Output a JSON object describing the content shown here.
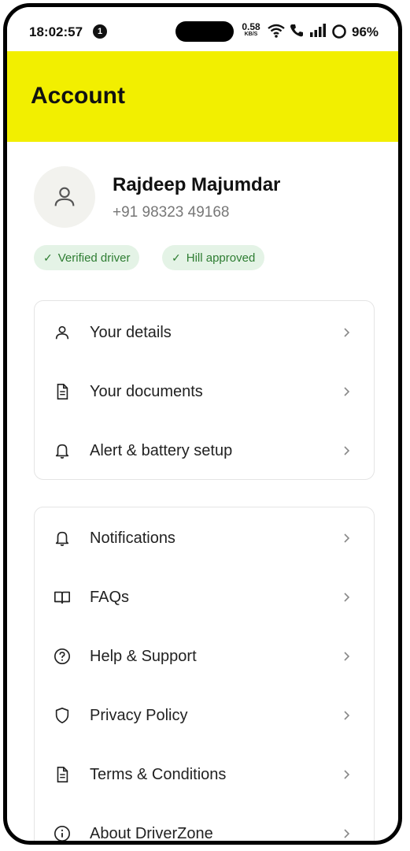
{
  "status_bar": {
    "time": "18:02:57",
    "notification_count": "1",
    "network_speed_value": "0.58",
    "network_speed_unit": "KB/S",
    "battery": "96%"
  },
  "header": {
    "title": "Account"
  },
  "profile": {
    "name": "Rajdeep Majumdar",
    "phone": "+91 98323 49168",
    "badges": [
      {
        "label": "Verified driver"
      },
      {
        "label": "Hill approved"
      }
    ]
  },
  "account_menu": {
    "items": [
      {
        "label": "Your details",
        "icon": "person-icon"
      },
      {
        "label": "Your documents",
        "icon": "document-icon"
      },
      {
        "label": "Alert & battery setup",
        "icon": "bell-icon"
      }
    ]
  },
  "support_menu": {
    "items": [
      {
        "label": "Notifications",
        "icon": "bell-icon"
      },
      {
        "label": "FAQs",
        "icon": "book-icon"
      },
      {
        "label": "Help & Support",
        "icon": "help-circle-icon"
      },
      {
        "label": "Privacy Policy",
        "icon": "shield-icon"
      },
      {
        "label": "Terms & Conditions",
        "icon": "document-icon"
      },
      {
        "label": "About DriverZone",
        "icon": "info-icon"
      }
    ]
  },
  "colors": {
    "header_bg": "#f2ef00",
    "badge_bg": "#e4f3e6",
    "badge_text": "#2e7d32"
  }
}
